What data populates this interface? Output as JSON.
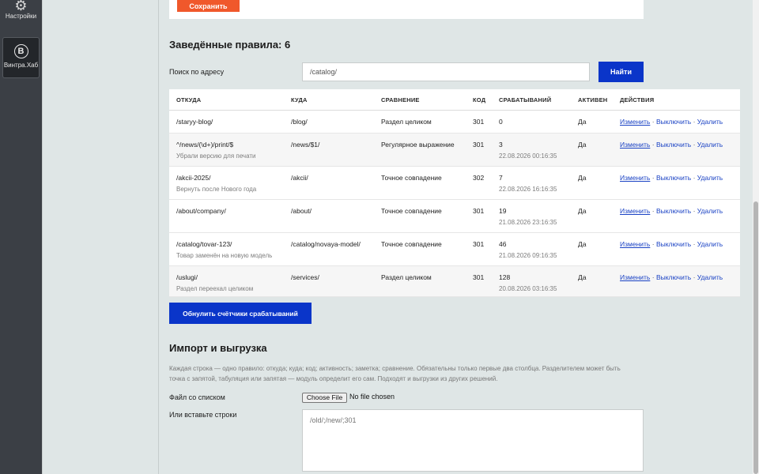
{
  "sidebar": {
    "settings_label": "Настройки",
    "hub_letter": "B",
    "hub_label": "Винтра.Хаб"
  },
  "top": {
    "save_label": "Сохранить"
  },
  "rules": {
    "title": "Заведённые правила: 6",
    "search_label": "Поиск по адресу",
    "search_value": "/catalog/",
    "find_label": "Найти",
    "columns": [
      "ОТКУДА",
      "КУДА",
      "СРАВНЕНИЕ",
      "КОД",
      "СРАБАТЫВАНИЙ",
      "АКТИВЕН",
      "ДЕЙСТВИЯ"
    ],
    "actions": {
      "edit": "Изменить",
      "disable": "Выключить",
      "delete": "Удалить",
      "separator": "·"
    },
    "rows": [
      {
        "from": "/staryy-blog/",
        "note": "",
        "to": "/blog/",
        "match": "Раздел целиком",
        "code": "301",
        "hits": "0",
        "last": "",
        "active": "Да"
      },
      {
        "from": "^/news/(\\d+)/print/$",
        "note": "Убрали версию для печати",
        "to": "/news/$1/",
        "match": "Регулярное выражение",
        "code": "301",
        "hits": "3",
        "last": "22.08.2026 00:16:35",
        "active": "Да"
      },
      {
        "from": "/akcii-2025/",
        "note": "Вернуть после Нового года",
        "to": "/akcii/",
        "match": "Точное совпадение",
        "code": "302",
        "hits": "7",
        "last": "22.08.2026 16:16:35",
        "active": "Да"
      },
      {
        "from": "/about/company/",
        "note": "",
        "to": "/about/",
        "match": "Точное совпадение",
        "code": "301",
        "hits": "19",
        "last": "21.08.2026 23:16:35",
        "active": "Да"
      },
      {
        "from": "/catalog/tovar-123/",
        "note": "Товар заменён на новую модель",
        "to": "/catalog/novaya-model/",
        "match": "Точное совпадение",
        "code": "301",
        "hits": "46",
        "last": "21.08.2026 09:16:35",
        "active": "Да"
      },
      {
        "from": "/uslugi/",
        "note": "Раздел переехал целиком",
        "to": "/services/",
        "match": "Раздел целиком",
        "code": "301",
        "hits": "128",
        "last": "20.08.2026 03:16:35",
        "active": "Да"
      }
    ],
    "reset_label": "Обнулить счётчики срабатываний"
  },
  "import": {
    "title": "Импорт и выгрузка",
    "description": "Каждая строка — одно правило: откуда; куда; код; активность; заметка; сравнение. Обязательны только первые два столбца. Разделителем может быть точка с запятой, табуляция или запятая — модуль определит его сам. Подходят и выгрузки из других решений.",
    "file_label": "Файл со списком",
    "file_button": "Choose File",
    "file_status": "No file chosen",
    "paste_label": "Или вставьте строки",
    "paste_placeholder": "/old/;/new/;301"
  }
}
